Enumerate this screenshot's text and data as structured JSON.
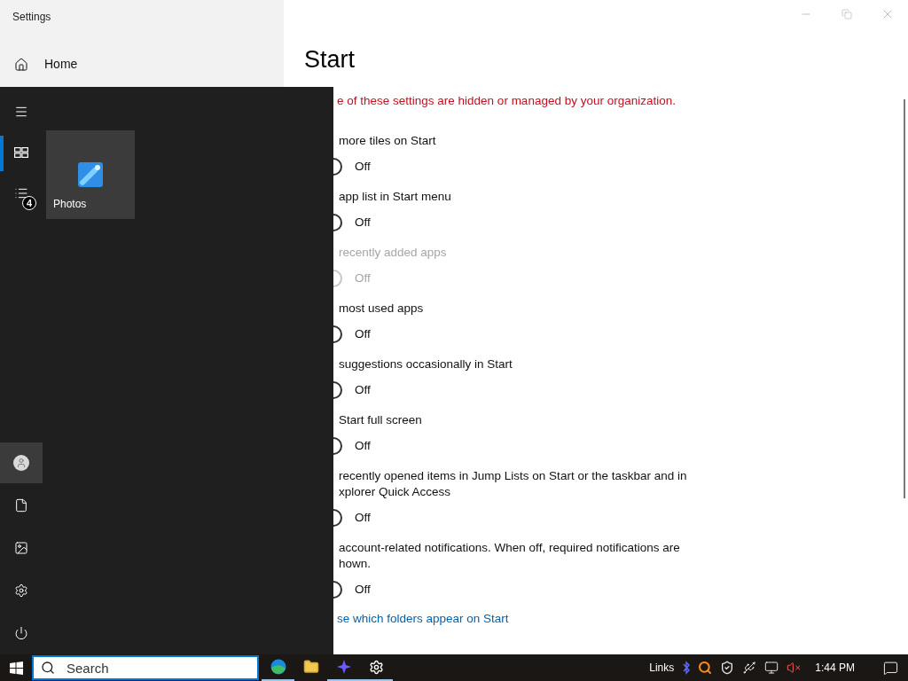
{
  "window": {
    "title": "Settings"
  },
  "sidebar": {
    "items": [
      {
        "label": "Home"
      }
    ]
  },
  "page": {
    "title": "Start",
    "notice": "e of these settings are hidden or managed by your organization.",
    "settings": [
      {
        "label": "more tiles on Start",
        "on": false,
        "disabled": false,
        "state": "Off"
      },
      {
        "label": "app list in Start menu",
        "on": false,
        "disabled": false,
        "state": "Off"
      },
      {
        "label": "recently added apps",
        "on": false,
        "disabled": true,
        "state": "Off"
      },
      {
        "label": "most used apps",
        "on": false,
        "disabled": false,
        "state": "Off"
      },
      {
        "label": "suggestions occasionally in Start",
        "on": false,
        "disabled": false,
        "state": "Off"
      },
      {
        "label": "Start full screen",
        "on": false,
        "disabled": false,
        "state": "Off"
      },
      {
        "label": "recently opened items in Jump Lists on Start or the taskbar and in xplorer Quick Access",
        "on": false,
        "disabled": false,
        "state": "Off"
      },
      {
        "label": "account-related notifications. When off, required notifications are hown.",
        "on": false,
        "disabled": false,
        "state": "Off"
      }
    ],
    "link": "se which folders appear on Start"
  },
  "start_menu": {
    "rail_top": [
      {
        "kind": "menu",
        "selected": false
      },
      {
        "kind": "tiles",
        "selected": true
      },
      {
        "kind": "list",
        "selected": false,
        "badge": "4"
      }
    ],
    "rail_bottom": [
      {
        "kind": "user",
        "hovered": true
      },
      {
        "kind": "document",
        "hovered": false
      },
      {
        "kind": "pictures",
        "hovered": false
      },
      {
        "kind": "settings",
        "hovered": false
      },
      {
        "kind": "power",
        "hovered": false
      }
    ],
    "tiles": [
      {
        "label": "Photos"
      }
    ]
  },
  "taskbar": {
    "search": {
      "placeholder": "Search"
    },
    "apps": [
      {
        "kind": "edge",
        "running": true
      },
      {
        "kind": "explorer",
        "running": false
      },
      {
        "kind": "app",
        "running": true
      },
      {
        "kind": "settings",
        "running": true
      }
    ],
    "tray_label": "Links",
    "clock": "1:44 PM"
  }
}
